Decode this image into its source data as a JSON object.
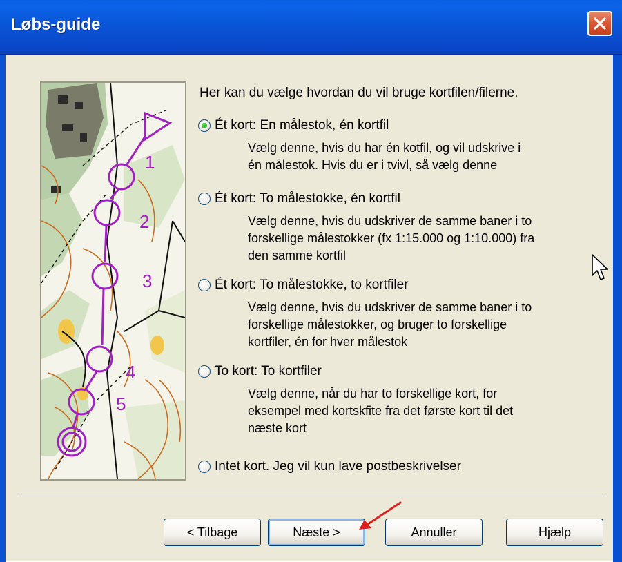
{
  "window": {
    "title": "Løbs-guide",
    "close_symbol": "×"
  },
  "intro_text": "Her kan du vælge hvordan du vil bruge kortfilen/filerne.",
  "options": [
    {
      "label": "Ét kort: En målestok, én kortfil",
      "checked": true,
      "description": [
        "Vælg denne, hvis du har én kotfil, og vil udskrive i",
        "én målestok.  Hvis du er i tvivl, så vælg denne"
      ]
    },
    {
      "label": "Ét kort: To målestokke, én kortfil",
      "checked": false,
      "description": [
        "Vælg denne, hvis du udskriver de samme baner i to",
        "forskellige målestokker (fx 1:15.000 og 1:10.000) fra",
        "den samme kortfil"
      ]
    },
    {
      "label": "Ét kort: To målestokke, to kortfiler",
      "checked": false,
      "description": [
        "Vælg denne, hvis du udskriver de samme baner i to",
        "forskellige målestokker, og bruger to forskellige",
        "kortfiler, én for hver målestok"
      ]
    },
    {
      "label": "To kort: To kortfiler",
      "checked": false,
      "description": [
        "Vælg denne, når du har to forskellige kort, for",
        "eksempel med kortskfite fra det første kort til det",
        "næste kort"
      ]
    },
    {
      "label": "Intet kort.  Jeg vil kun lave postbeskrivelser",
      "checked": false,
      "description": []
    }
  ],
  "map_control_numbers": [
    "1",
    "2",
    "3",
    "4",
    "5"
  ],
  "buttons": {
    "back": "< Tilbage",
    "next": "Næste >",
    "cancel": "Annuller",
    "help": "Hjælp"
  },
  "colors": {
    "titlebar": "#0a52d3",
    "dialog_bg": "#ece9d8",
    "course_purple": "#a020c0",
    "annotation_arrow": "#e02020"
  }
}
